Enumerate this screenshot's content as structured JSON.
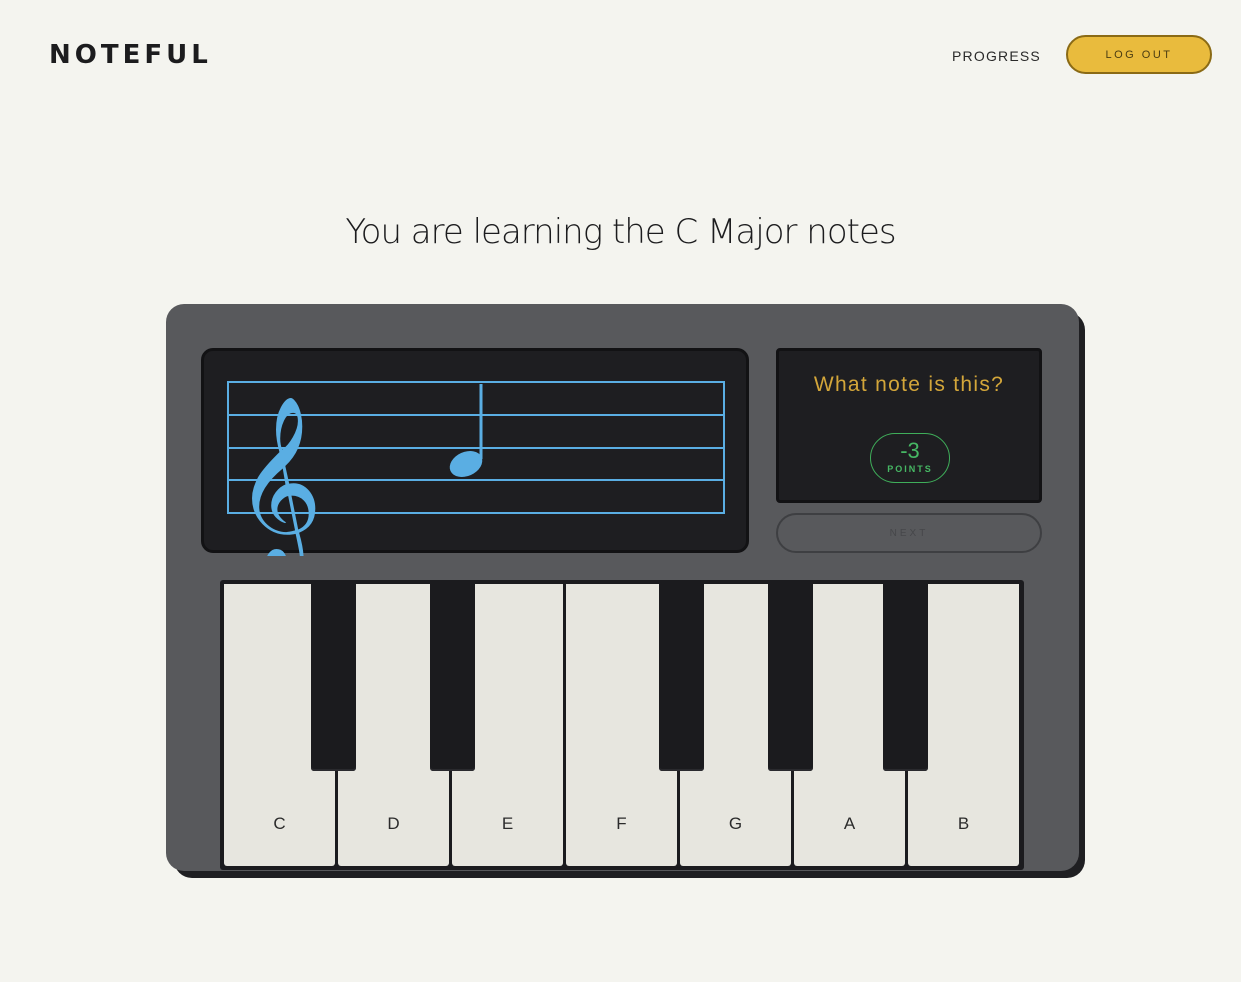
{
  "header": {
    "logo": "NOTEFUL",
    "nav_progress": "PROGRESS",
    "logout_label": "LOG OUT"
  },
  "main": {
    "heading": "You are learning the C Major notes"
  },
  "quiz": {
    "question": "What note is this?",
    "points_value": "-3",
    "points_label": "POINTS",
    "next_label": "NEXT"
  },
  "keyboard": {
    "white_keys": [
      "C",
      "D",
      "E",
      "F",
      "G",
      "A",
      "B"
    ]
  },
  "colors": {
    "accent_yellow": "#e9bb3d",
    "staff_blue": "#5aaee3",
    "points_green": "#46b864",
    "question_gold": "#d3a63a"
  },
  "icons": {
    "clef": "treble-clef-icon",
    "note": "quarter-note-icon"
  }
}
